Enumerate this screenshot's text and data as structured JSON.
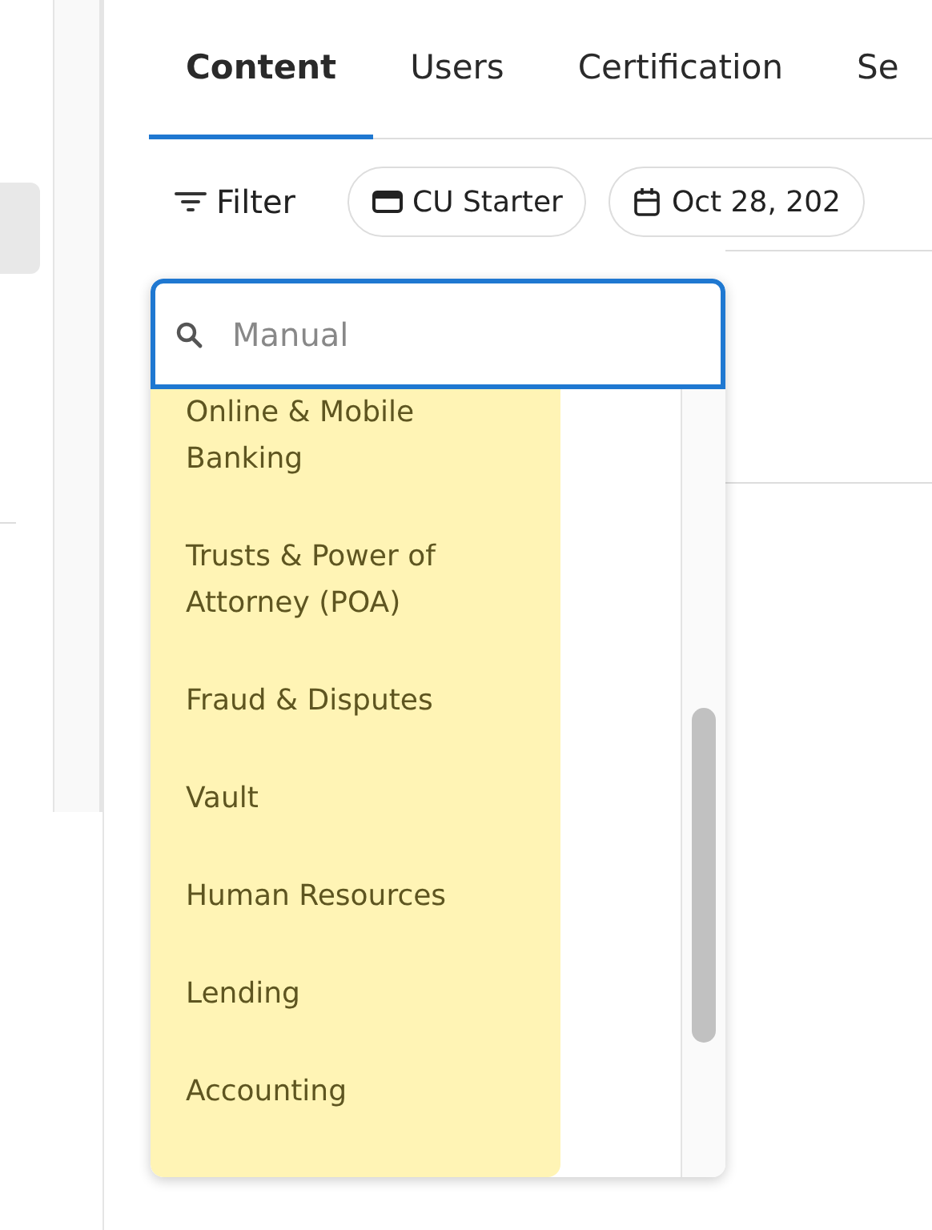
{
  "tabs": [
    {
      "label": "Content",
      "selected": true
    },
    {
      "label": "Users",
      "selected": false
    },
    {
      "label": "Certification",
      "selected": false
    },
    {
      "label": "Se",
      "selected": false
    }
  ],
  "filter": {
    "label": "Filter"
  },
  "chips": [
    {
      "kind": "product",
      "label": "CU Starter"
    },
    {
      "kind": "date",
      "label": "Oct 28, 202"
    }
  ],
  "dropdown": {
    "search": {
      "placeholder": "Manual"
    },
    "options": [
      "Online & Mobile Banking",
      "Trusts & Power of Attorney (POA)",
      "Fraud & Disputes",
      "Vault",
      "Human Resources",
      "Lending",
      "Accounting"
    ]
  }
}
